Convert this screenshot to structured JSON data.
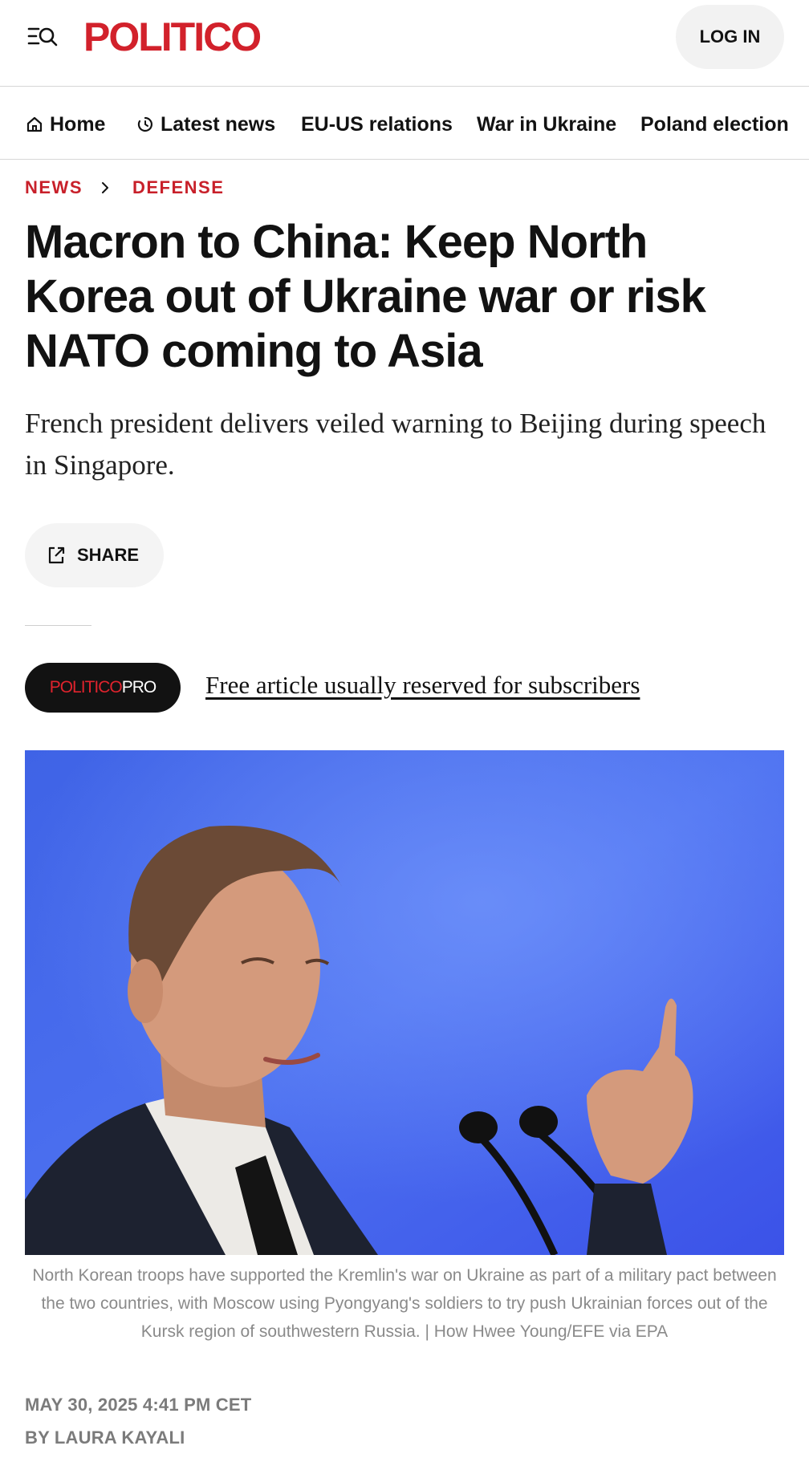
{
  "header": {
    "logo_text": "POLITICO",
    "login_label": "LOG IN",
    "menu_icon": "menu-search-icon",
    "brand_color": "#d2212b"
  },
  "nav": {
    "items": [
      {
        "label": "Home",
        "icon": "home-icon"
      },
      {
        "label": "Latest news",
        "icon": "clock-icon"
      },
      {
        "label": "EU-US relations"
      },
      {
        "label": "War in Ukraine"
      },
      {
        "label": "Poland election"
      }
    ]
  },
  "breadcrumb": {
    "items": [
      "NEWS",
      "DEFENSE"
    ],
    "separator_icon": "chevron-right-icon"
  },
  "article": {
    "headline": "Macron to China: Keep North Korea out of Ukraine war or risk NATO coming to Asia",
    "dek": "French president delivers veiled warning to Beijing during speech in Singapore.",
    "share_label": "SHARE",
    "pro_badge": {
      "part1": "POLITICO",
      "part2": "PRO"
    },
    "free_article_text": "Free article usually reserved for subscribers",
    "image_caption": "North Korean troops have supported the Kremlin's war on Ukraine as part of a military pact between the two countries, with Moscow using Pyongyang's soldiers to try push Ukrainian forces out of the Kursk region of southwestern Russia. | How Hwee Young/EFE via EPA",
    "dateline": "MAY 30, 2025 4:41 PM CET",
    "byline": "BY LAURA KAYALI"
  },
  "colors": {
    "accent_red": "#c8202a",
    "text": "#121212",
    "muted": "#7b7b7b"
  }
}
